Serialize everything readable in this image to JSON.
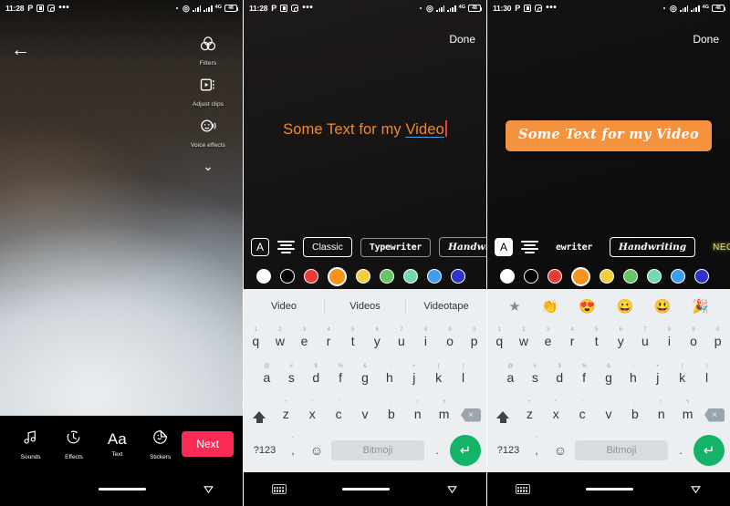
{
  "panels": [
    {
      "status": {
        "time": "11:28",
        "icons": [
          "P",
          "messenger-icon",
          "instagram-icon",
          "more-dots"
        ],
        "right": {
          "dot": "•",
          "wifi": "wifi-icon",
          "signal1": "signal-icon",
          "signal2": "signal-icon",
          "data": "4G",
          "battery": "48"
        }
      },
      "back_label": "←",
      "tools": [
        {
          "name": "filters",
          "label": "Filters"
        },
        {
          "name": "adjust-clips",
          "label": "Adjust clips"
        },
        {
          "name": "voice-effects",
          "label": "Voice effects"
        }
      ],
      "chevron": "⌄",
      "bottom": [
        {
          "name": "sounds",
          "label": "Sounds"
        },
        {
          "name": "effects",
          "label": "Effects"
        },
        {
          "name": "text",
          "label": "Text"
        },
        {
          "name": "stickers",
          "label": "Stickers"
        }
      ],
      "next_label": "Next",
      "next_color": "#fb2b55"
    },
    {
      "status": {
        "time": "11:28",
        "data": "4G",
        "battery": "48"
      },
      "done_label": "Done",
      "text_value": "Some Text for my ",
      "text_underlined": "Video",
      "text_color": "#f08a2e",
      "underline_color": "#3da5e0",
      "caret_color": "#e8432f",
      "fonts": [
        {
          "label": "Classic",
          "selected": true
        },
        {
          "label": "Typewriter",
          "selected": false
        },
        {
          "label": "Handwriting",
          "selected": false
        }
      ],
      "colors": [
        "#ffffff",
        "#000000",
        "#ef3b36",
        "#f7941e",
        "#f4cf3d",
        "#65c564",
        "#76d9ae",
        "#3d9ff0",
        "#2f33c8"
      ],
      "selected_color_index": 3,
      "suggestions": [
        "Video",
        "Videos",
        "Videotape"
      ]
    },
    {
      "status": {
        "time": "11:30",
        "data": "4G",
        "battery": "48"
      },
      "done_label": "Done",
      "text_value": "Some Text for my Video",
      "chip_color": "#f5923e",
      "text_color": "#ffffff",
      "fonts": [
        {
          "label": "ewriter",
          "selected": false
        },
        {
          "label": "Handwriting",
          "selected": true
        },
        {
          "label": "NEON",
          "selected": false
        }
      ],
      "colors": [
        "#ffffff",
        "#000000",
        "#ef3b36",
        "#f7941e",
        "#f4cf3d",
        "#65c564",
        "#76d9ae",
        "#3d9ff0",
        "#2f33c8"
      ],
      "selected_color_index": 3,
      "emoji_suggestions": [
        "★",
        "👏",
        "😍",
        "😀",
        "😃",
        "🎉"
      ]
    }
  ],
  "keyboard": {
    "row1": [
      {
        "k": "q",
        "n": "1"
      },
      {
        "k": "w",
        "n": "2"
      },
      {
        "k": "e",
        "n": "3"
      },
      {
        "k": "r",
        "n": "4"
      },
      {
        "k": "t",
        "n": "5"
      },
      {
        "k": "y",
        "n": "6"
      },
      {
        "k": "u",
        "n": "7"
      },
      {
        "k": "i",
        "n": "8"
      },
      {
        "k": "o",
        "n": "9"
      },
      {
        "k": "p",
        "n": "0"
      }
    ],
    "row2": [
      {
        "k": "a",
        "n": "@"
      },
      {
        "k": "s",
        "n": "#"
      },
      {
        "k": "d",
        "n": "$"
      },
      {
        "k": "f",
        "n": "%"
      },
      {
        "k": "g",
        "n": "&"
      },
      {
        "k": "h",
        "n": "-"
      },
      {
        "k": "j",
        "n": "+"
      },
      {
        "k": "k",
        "n": "("
      },
      {
        "k": "l",
        "n": ")"
      }
    ],
    "row3": [
      {
        "k": "z",
        "n": "*"
      },
      {
        "k": "x",
        "n": "\""
      },
      {
        "k": "c",
        "n": "'"
      },
      {
        "k": "v",
        "n": ":"
      },
      {
        "k": "b",
        "n": ";"
      },
      {
        "k": "n",
        "n": "!"
      },
      {
        "k": "m",
        "n": "?"
      }
    ],
    "shift": "shift-key",
    "delete": "⌫",
    "numbers_label": "?123",
    "comma": ",",
    "comma_sup": "°",
    "emoji_key": "☺",
    "emoji_key_sup": "°",
    "space_label": "Bitmoji",
    "period": ".",
    "enter": "↵",
    "enter_color": "#14b367"
  },
  "navbar": {
    "keyboard_hide": "kbd-hide-icon",
    "home": "home-pill",
    "back": "back-triangle"
  }
}
